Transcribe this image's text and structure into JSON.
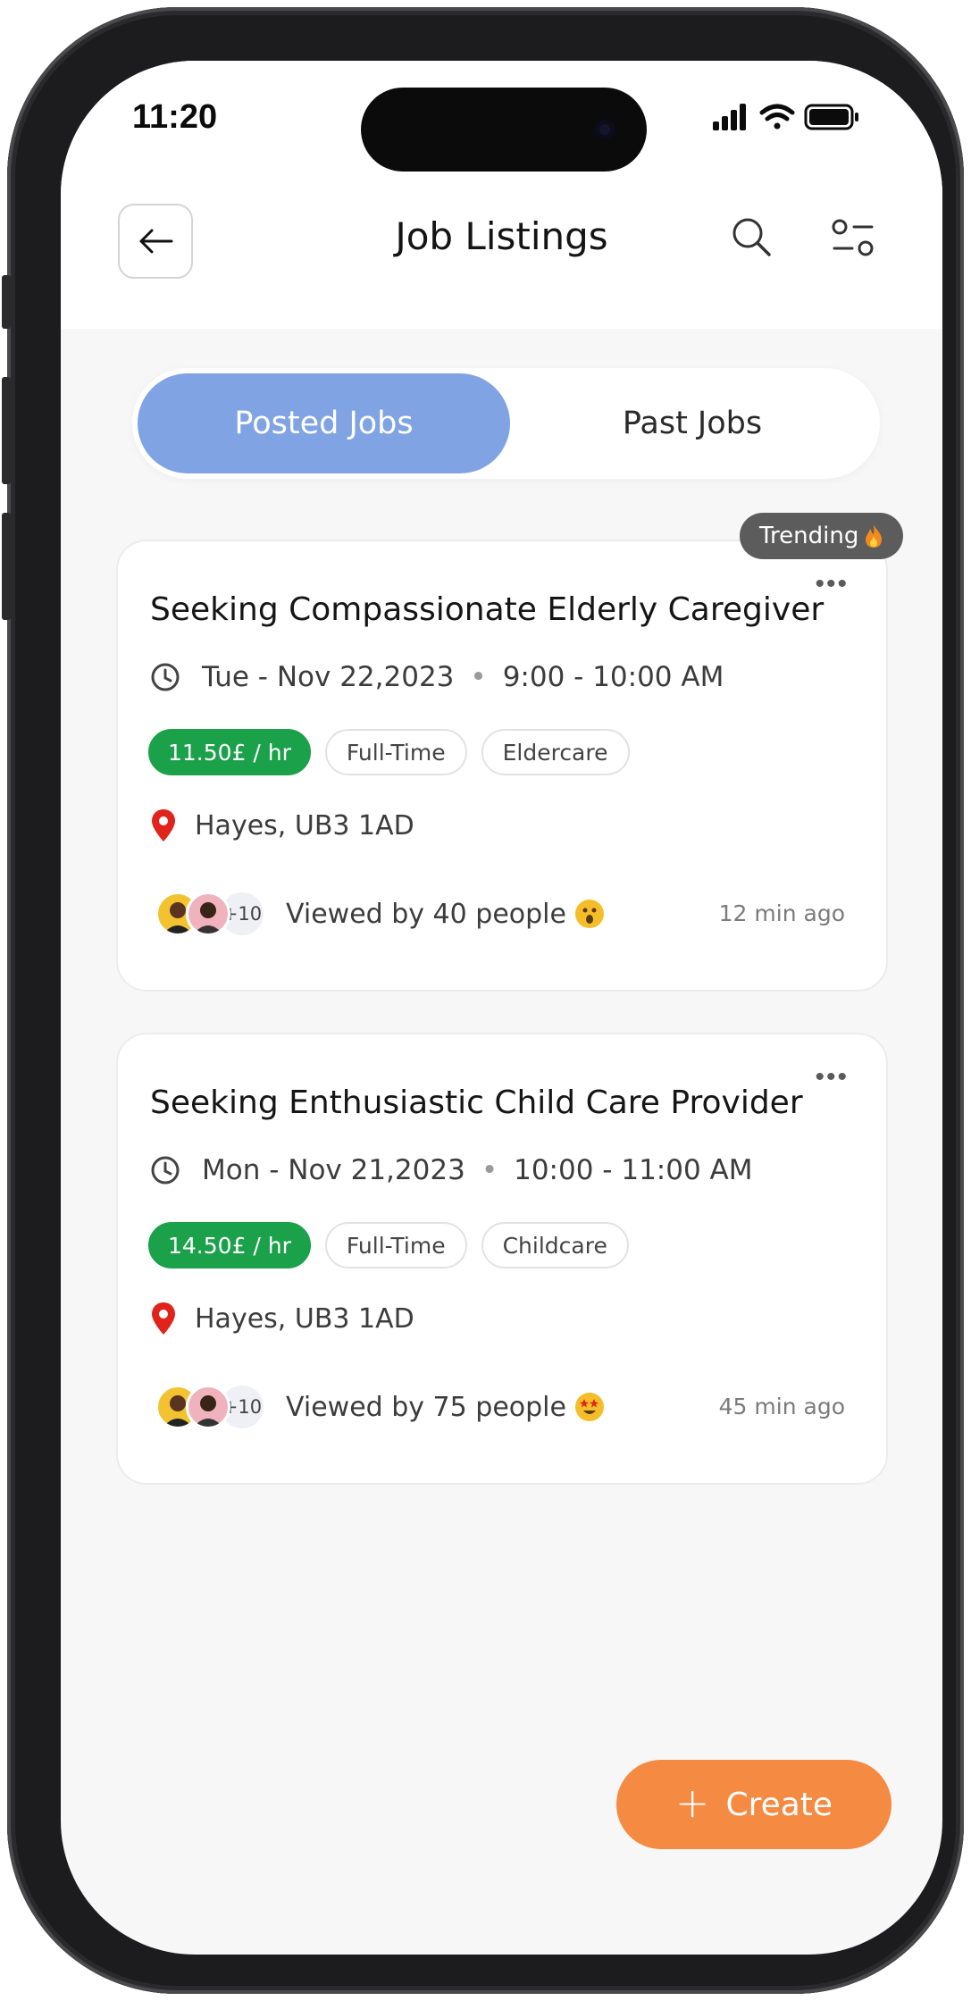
{
  "status_bar": {
    "time": "11:20"
  },
  "header": {
    "title": "Job Listings"
  },
  "tabs": [
    {
      "label": "Posted Jobs",
      "active": true
    },
    {
      "label": "Past Jobs",
      "active": false
    }
  ],
  "jobs": [
    {
      "badge": "Trending",
      "title": "Seeking Compassionate Elderly Caregiver",
      "date": "Tue - Nov 22,2023",
      "time": "9:00 - 10:00 AM",
      "rate": "11.50£ / hr",
      "type": "Full-Time",
      "category": "Eldercare",
      "location": "Hayes, UB3 1AD",
      "viewers_extra": "+10",
      "viewed": "Viewed by 40 people",
      "posted": "12 min ago"
    },
    {
      "title": "Seeking Enthusiastic Child Care Provider",
      "date": "Mon - Nov 21,2023",
      "time": "10:00 - 11:00 AM",
      "rate": "14.50£ / hr",
      "type": "Full-Time",
      "category": "Childcare",
      "location": "Hayes, UB3 1AD",
      "viewers_extra": "+10",
      "viewed": "Viewed by 75 people",
      "posted": "45 min ago"
    }
  ],
  "fab": {
    "label": "Create"
  },
  "colors": {
    "tab_active": "#7fa3e3",
    "rate_tag": "#1aa14a",
    "fab": "#f58a42",
    "pin": "#e0241b",
    "trending_badge": "#5c5c5c"
  }
}
